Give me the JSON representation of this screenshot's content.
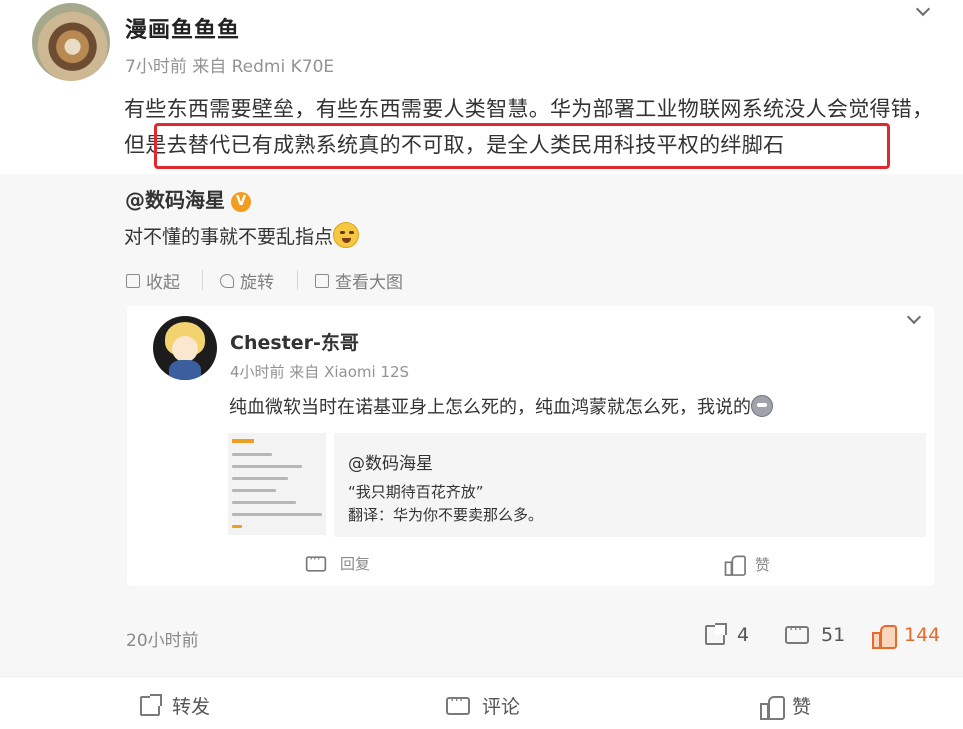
{
  "post": {
    "username": "漫画鱼鱼鱼",
    "meta": "7小时前  来自 Redmi K70E",
    "text": "有些东西需要壁垒，有些东西需要人类智慧。华为部署工业物联网系统没人会觉得错，但是去替代已有成熟系统真的不可取，是全人类民用科技平权的绊脚石",
    "time": "20小时前",
    "stats": {
      "reposts": "4",
      "comments": "51",
      "likes": "144"
    }
  },
  "repost": {
    "user": "@数码海星",
    "verified_badge": "V",
    "text": "对不懂的事就不要乱指点",
    "actions": {
      "collapse": "收起",
      "rotate": "旋转",
      "view_large": "查看大图"
    }
  },
  "inner_card": {
    "username": "Chester-东哥",
    "meta": "4小时前  来自 Xiaomi 12S",
    "text": "纯血微软当时在诺基亚身上怎么死的，纯血鸿蒙就怎么死，我说的",
    "quote": {
      "user": "@数码海星",
      "line1": "“我只期待百花齐放”",
      "line2": "翻译：华为你不要卖那么多。"
    },
    "reply_label": "回复",
    "like_label": "赞"
  },
  "bottom_bar": {
    "repost": "转发",
    "comment": "评论",
    "like": "赞"
  },
  "colors": {
    "accent_like": "#e86a2a",
    "highlight_border": "#e0282e",
    "verified": "#f29d1f"
  },
  "icons": [
    "chevron-down-icon",
    "collapse-icon",
    "rotate-icon",
    "zoom-icon",
    "share-icon",
    "comment-icon",
    "thumbs-up-icon"
  ]
}
